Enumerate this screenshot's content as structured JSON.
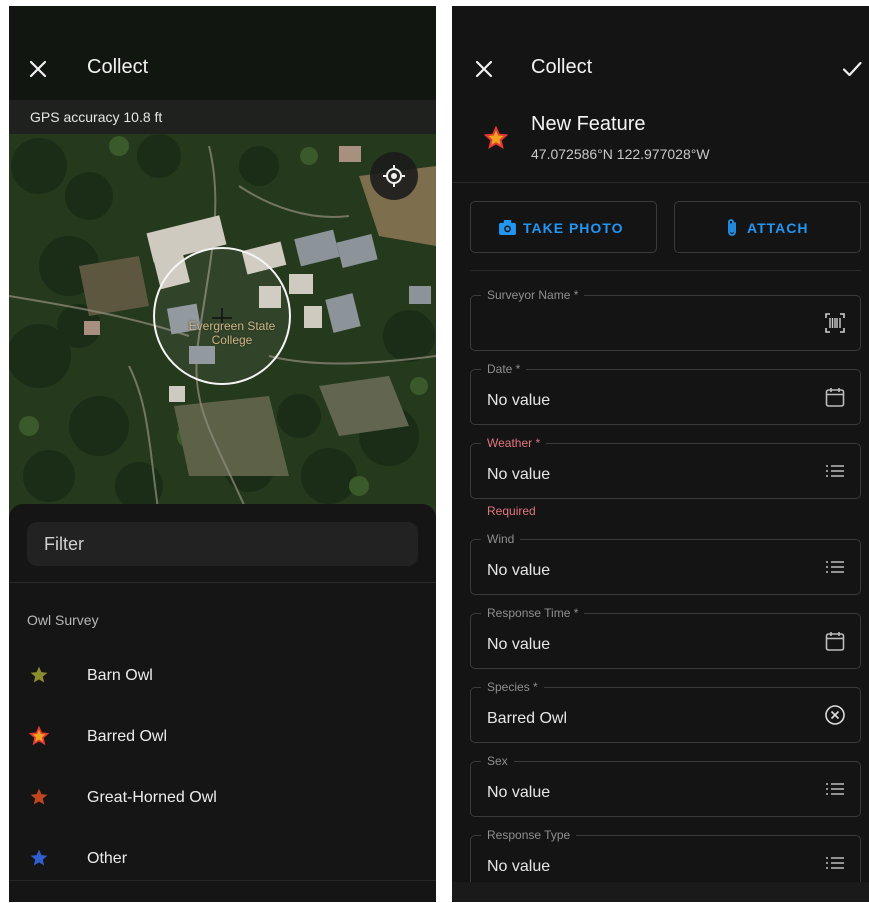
{
  "left": {
    "title": "Collect",
    "gps_accuracy": "GPS accuracy 10.8 ft",
    "map_label": "Evergreen State College",
    "filter": {
      "placeholder": "Filter",
      "value": ""
    },
    "section_title": "Owl Survey",
    "items": [
      {
        "label": "Barn Owl",
        "icon": "star-icon",
        "color": "#8b8b2f"
      },
      {
        "label": "Barred Owl",
        "icon": "star-icon",
        "color": "#f2a31e",
        "stroke": "#e53935"
      },
      {
        "label": "Great-Horned Owl",
        "icon": "star-icon",
        "color": "#c0461f"
      },
      {
        "label": "Other",
        "icon": "star-icon",
        "color": "#2f5fcf"
      }
    ]
  },
  "right": {
    "title": "Collect",
    "feature_title": "New Feature",
    "feature_coords": "47.072586°N  122.977028°W",
    "buttons": {
      "take_photo": "TAKE PHOTO",
      "attach": "ATTACH"
    },
    "accent_color": "#2196f3",
    "error_color": "#e07680",
    "fields": [
      {
        "label": "Surveyor Name *",
        "value": "",
        "icon": "barcode-scan-icon"
      },
      {
        "label": "Date *",
        "value": "No value",
        "icon": "calendar-icon"
      },
      {
        "label": "Weather *",
        "value": "No value",
        "icon": "list-icon",
        "error": "Required"
      },
      {
        "label": "Wind",
        "value": "No value",
        "icon": "list-icon"
      },
      {
        "label": "Response Time *",
        "value": "No value",
        "icon": "calendar-icon"
      },
      {
        "label": "Species *",
        "value": "Barred Owl",
        "icon": "clear-circle-icon"
      },
      {
        "label": "Sex",
        "value": "No value",
        "icon": "list-icon"
      },
      {
        "label": "Response Type",
        "value": "No value",
        "icon": "list-icon"
      }
    ]
  }
}
